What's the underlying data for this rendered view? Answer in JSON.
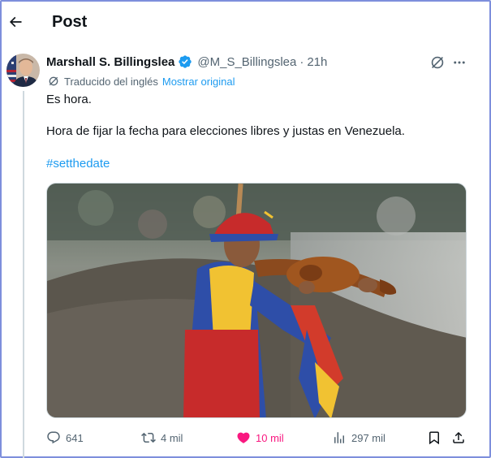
{
  "header": {
    "title": "Post"
  },
  "post": {
    "author_name": "Marshall S. Billingslea",
    "handle": "@M_S_Billingslea",
    "separator": "·",
    "time": "21h",
    "translated_label": "Traducido del inglés",
    "show_original": "Mostrar original",
    "text_line1": "Es hora.",
    "text_line2": "Hora de fijar la fecha para elecciones libres y justas en Venezuela.",
    "hashtag": "#setthedate"
  },
  "actions": {
    "replies": "641",
    "reposts": "4 mil",
    "likes": "10 mil",
    "views": "297 mil"
  },
  "colors": {
    "accent": "#1d9bf0",
    "like": "#f91880",
    "secondary_text": "#536471",
    "verified": "#1d9bf0",
    "border": "#7d8fdc"
  },
  "icons": [
    "back-arrow-icon",
    "verified-badge-icon",
    "grok-icon",
    "more-icon",
    "translate-icon",
    "reply-icon",
    "repost-icon",
    "like-icon",
    "views-icon",
    "bookmark-icon",
    "share-icon"
  ]
}
